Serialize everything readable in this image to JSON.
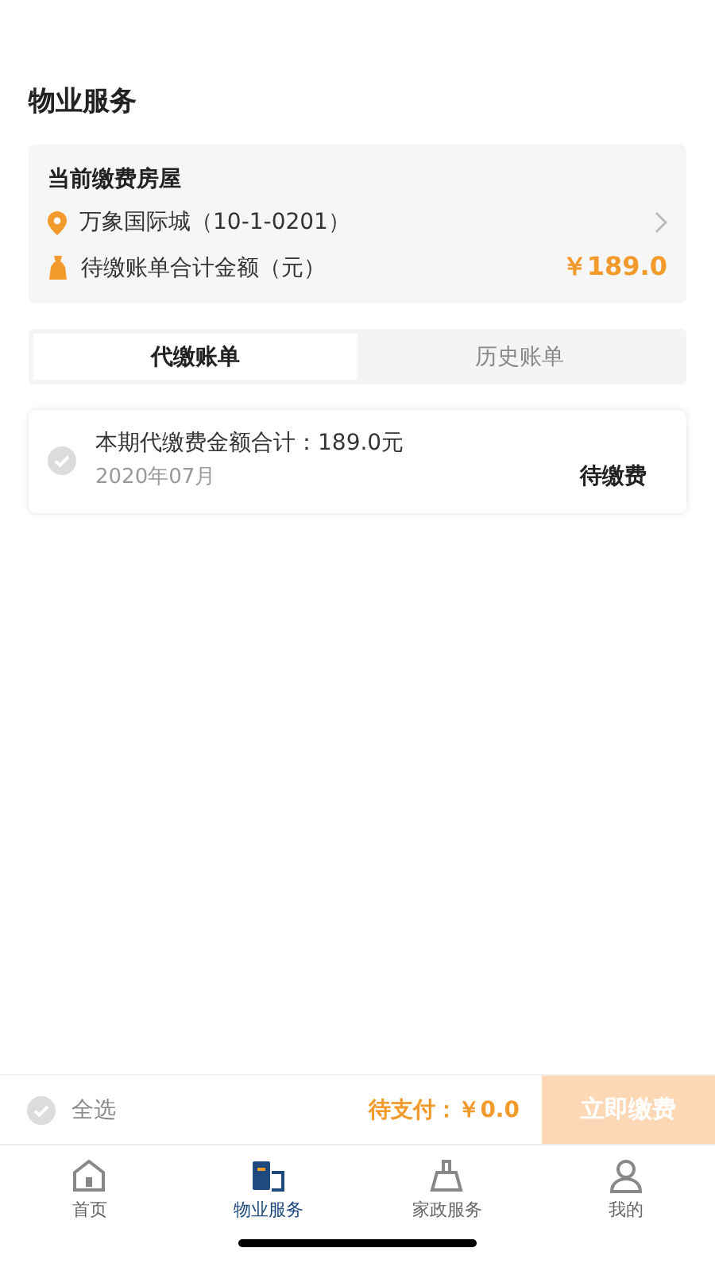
{
  "header": {
    "title": "物业服务"
  },
  "house_card": {
    "title": "当前缴费房屋",
    "address": "万象国际城（10-1-0201）",
    "total_label": "待缴账单合计金额（元）",
    "total_amount": "￥189.0"
  },
  "tabs": [
    {
      "label": "代缴账单",
      "selected": true
    },
    {
      "label": "历史账单",
      "selected": false
    }
  ],
  "bills": [
    {
      "title": "本期代缴费金额合计：189.0元",
      "period": "2020年07月",
      "status": "待缴费",
      "checked": false
    }
  ],
  "pay_bar": {
    "select_all": "全选",
    "all_checked": false,
    "pending_label": "待支付：￥0.0",
    "pay_button": "立即缴费",
    "pay_disabled": true
  },
  "nav": [
    {
      "label": "首页",
      "kind": "home",
      "selected": false
    },
    {
      "label": "物业服务",
      "kind": "property",
      "selected": true
    },
    {
      "label": "家政服务",
      "kind": "cleaning",
      "selected": false
    },
    {
      "label": "我的",
      "kind": "profile",
      "selected": false
    }
  ]
}
